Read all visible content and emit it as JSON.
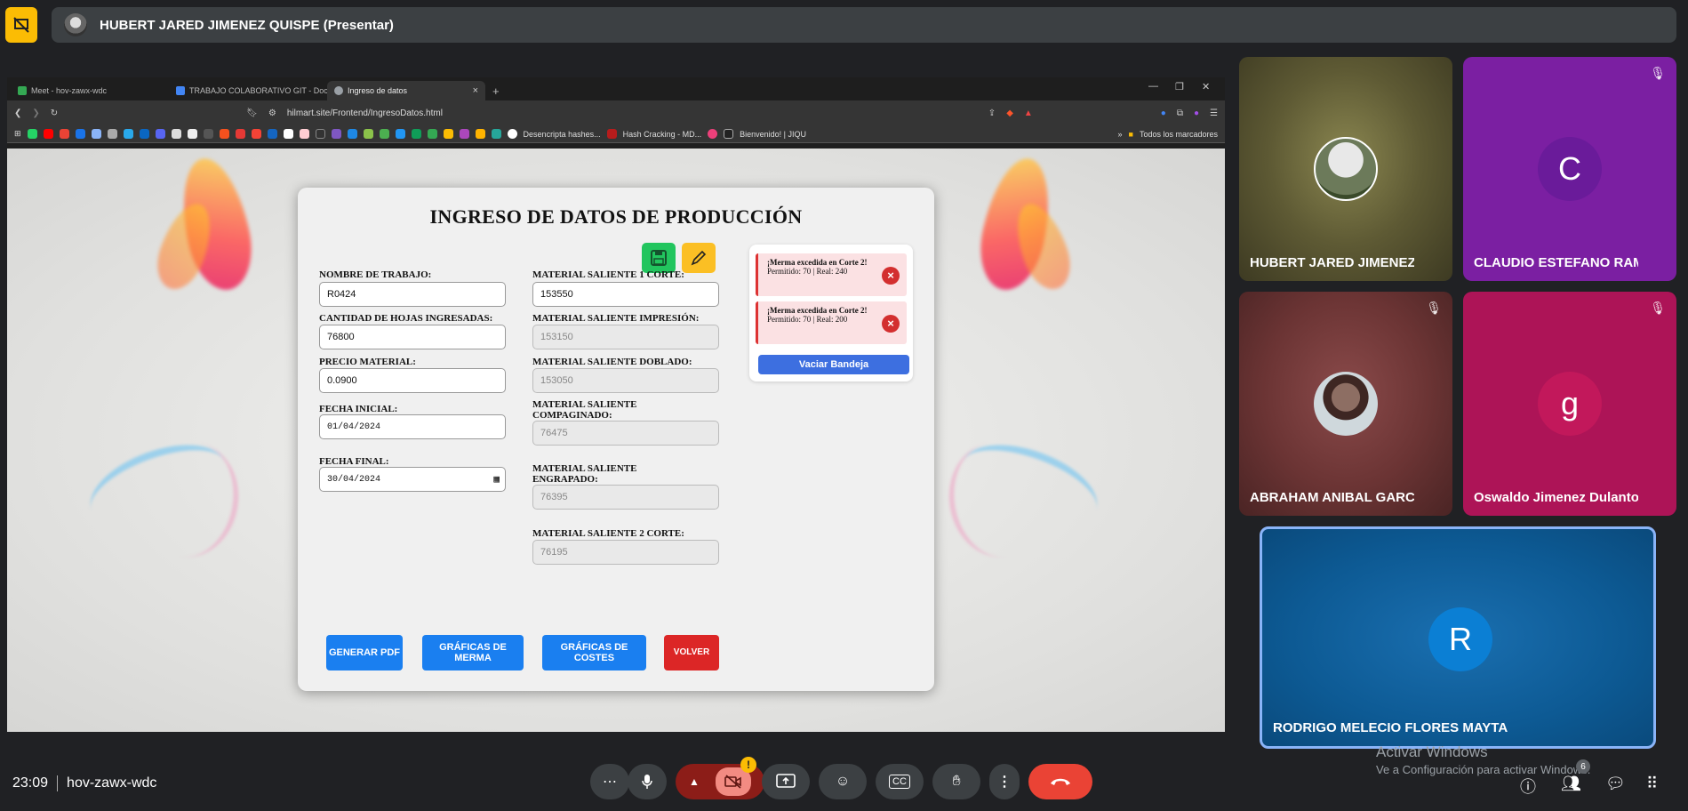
{
  "presenter": {
    "title": "HUBERT JARED JIMENEZ QUISPE (Presentar)"
  },
  "browser": {
    "tabs": [
      {
        "label": "Meet - hov-zawx-wdc",
        "active": false
      },
      {
        "label": "TRABAJO COLABORATIVO GIT - Doc",
        "active": false
      },
      {
        "label": "Ingreso de datos",
        "active": true
      }
    ],
    "url": "hilmart.site/Frontend/IngresoDatos.html",
    "bookmarks": [
      "Desencripta hashes...",
      "Hash Cracking - MD...",
      "Bienvenido! | JIQU",
      "Todos los marcadores"
    ]
  },
  "form": {
    "title": "INGRESO DE DATOS DE PRODUCCIÓN",
    "nombre_label": "NOMBRE DE TRABAJO:",
    "nombre_value": "R0424",
    "hojas_label": "CANTIDAD DE HOJAS INGRESADAS:",
    "hojas_value": "76800",
    "precio_label": "PRECIO MATERIAL:",
    "precio_value": "0.0900",
    "fecha_ini_label": "FECHA INICIAL:",
    "fecha_ini_value": "01/04/2024",
    "fecha_fin_label": "FECHA FINAL:",
    "fecha_fin_value": "30/04/2024",
    "corte1_label": "MATERIAL SALIENTE 1 CORTE:",
    "corte1_value": "153550",
    "impresion_label": "MATERIAL SALIENTE IMPRESIÓN:",
    "impresion_value": "153150",
    "doblado_label": "MATERIAL SALIENTE DOBLADO:",
    "doblado_value": "153050",
    "compaginado_label": "MATERIAL SALIENTE COMPAGINADO:",
    "compaginado_value": "76475",
    "engrapado_label": "MATERIAL SALIENTE ENGRAPADO:",
    "engrapado_value": "76395",
    "corte2_label": "MATERIAL SALIENTE 2 CORTE:",
    "corte2_value": "76195",
    "buttons": {
      "pdf": "GENERAR PDF",
      "merma": "GRÁFICAS DE MERMA",
      "costes": "GRÁFICAS DE COSTES",
      "volver": "VOLVER"
    }
  },
  "alerts": [
    {
      "title": "¡Merma excedida en Corte 2!",
      "detail": "Permitido: 70 | Real: 240"
    },
    {
      "title": "¡Merma excedida en Corte 2!",
      "detail": "Permitido: 70 | Real: 200"
    }
  ],
  "tray_button": "Vaciar Bandeja",
  "participants": [
    {
      "name": "HUBERT JARED JIMENEZ ...",
      "initial": "",
      "muted": false
    },
    {
      "name": "CLAUDIO ESTEFANO RAM...",
      "initial": "C",
      "muted": true
    },
    {
      "name": "ABRAHAM ANIBAL GARCI...",
      "initial": "",
      "muted": true
    },
    {
      "name": "Oswaldo Jimenez Dulanto",
      "initial": "g",
      "muted": true
    },
    {
      "name": "RODRIGO MELECIO FLORES MAYTA",
      "initial": "R",
      "muted": false
    }
  ],
  "meeting": {
    "time": "23:09",
    "code": "hov-zawx-wdc",
    "people_count": "6"
  },
  "activate": {
    "line1": "Activar Windows",
    "line2": "Ve a Configuración para activar Windows."
  },
  "colors": {
    "accent_blue": "#1a73e8",
    "end_call": "#ea4335",
    "save_green": "#22c55e",
    "edit_yellow": "#fbbf24",
    "volver_red": "#dc2626"
  }
}
